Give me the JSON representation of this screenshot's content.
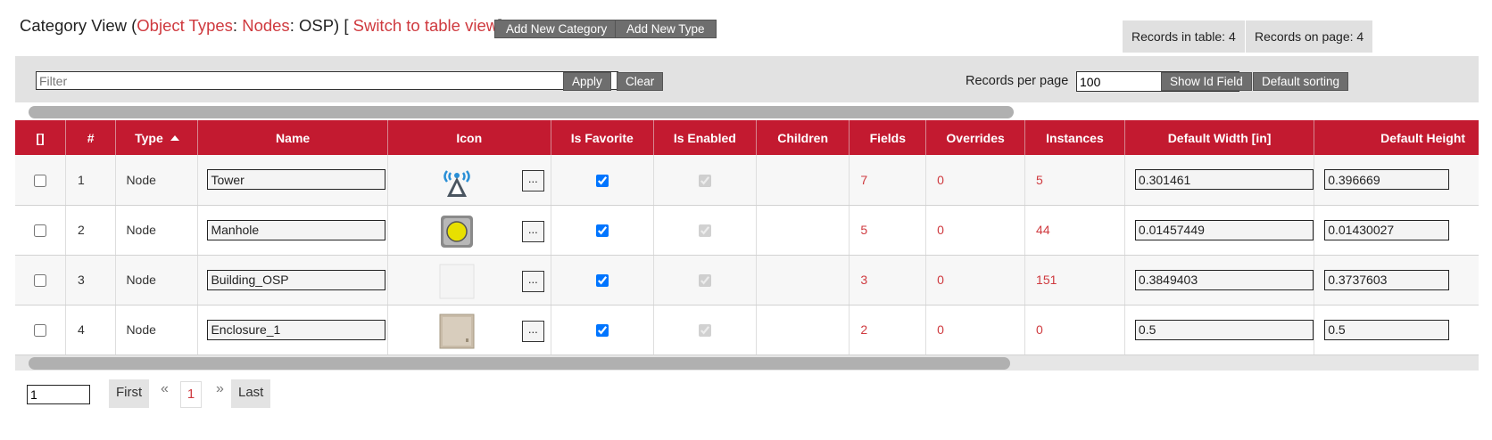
{
  "header": {
    "title_prefix": "Category View (",
    "object_types_link": "Object Types",
    "sep1": ": ",
    "nodes_link": "Nodes",
    "sep2": ": OSP) [ ",
    "switch_link": "Switch to table view",
    "title_suffix": "]",
    "add_category_label": "Add New Category",
    "add_type_label": "Add New Type",
    "records_in_table": "Records in table: 4",
    "records_on_page": "Records on page: 4"
  },
  "filter": {
    "placeholder": "Filter",
    "apply_label": "Apply",
    "clear_label": "Clear",
    "records_per_page_label": "Records per page",
    "records_per_page_value": "100",
    "show_id_label": "Show Id Field",
    "default_sorting_label": "Default sorting"
  },
  "table": {
    "columns": [
      "[]",
      "#",
      "Type",
      "Name",
      "Icon",
      "Is Favorite",
      "Is Enabled",
      "Children",
      "Fields",
      "Overrides",
      "Instances",
      "Default Width [in]",
      "Default Height"
    ],
    "icon_button_label": "...",
    "rows": [
      {
        "num": "1",
        "type": "Node",
        "name": "Tower",
        "icon": "tower-icon",
        "favorite": true,
        "enabled": true,
        "children": "",
        "fields": "7",
        "overrides": "0",
        "instances": "5",
        "width": "0.301461",
        "height": "0.396669"
      },
      {
        "num": "2",
        "type": "Node",
        "name": "Manhole",
        "icon": "manhole-icon",
        "favorite": true,
        "enabled": true,
        "children": "",
        "fields": "5",
        "overrides": "0",
        "instances": "44",
        "width": "0.01457449",
        "height": "0.01430027"
      },
      {
        "num": "3",
        "type": "Node",
        "name": "Building_OSP",
        "icon": "blank-icon",
        "favorite": true,
        "enabled": true,
        "children": "",
        "fields": "3",
        "overrides": "0",
        "instances": "151",
        "width": "0.3849403",
        "height": "0.3737603"
      },
      {
        "num": "4",
        "type": "Node",
        "name": "Enclosure_1",
        "icon": "enclosure-icon",
        "favorite": true,
        "enabled": true,
        "children": "",
        "fields": "2",
        "overrides": "0",
        "instances": "0",
        "width": "0.5",
        "height": "0.5"
      }
    ]
  },
  "pager": {
    "page_value": "1",
    "first_label": "First",
    "prev_label": "«",
    "current_page": "1",
    "next_label": "»",
    "last_label": "Last"
  },
  "colors": {
    "header_red": "#c31a30",
    "link_red": "#cf3a3f",
    "button_gray": "#6e6e6e"
  }
}
